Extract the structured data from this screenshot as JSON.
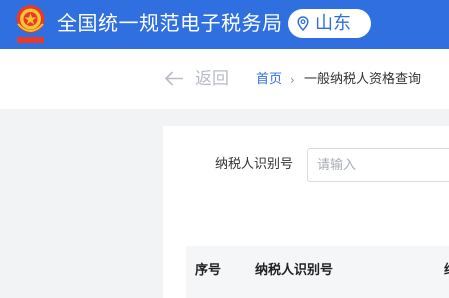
{
  "header": {
    "title": "全国统一规范电子税务局",
    "region": "山东",
    "icons": {
      "emblem": "national-tax-emblem",
      "location": "location-pin-icon"
    },
    "colors": {
      "brand": "#2f6fe0",
      "title_text": "#ffffff"
    }
  },
  "nav": {
    "back_label": "返回",
    "back_icon": "arrow-left-icon",
    "breadcrumb": {
      "home": "首页",
      "separator": "›",
      "current": "一般纳税人资格查询"
    }
  },
  "query_form": {
    "taxid_label": "纳税人识别号",
    "taxid_value": "",
    "taxid_placeholder": "请输入"
  },
  "results_table": {
    "columns": [
      "序号",
      "纳税人识别号",
      "纳"
    ],
    "rows": []
  }
}
